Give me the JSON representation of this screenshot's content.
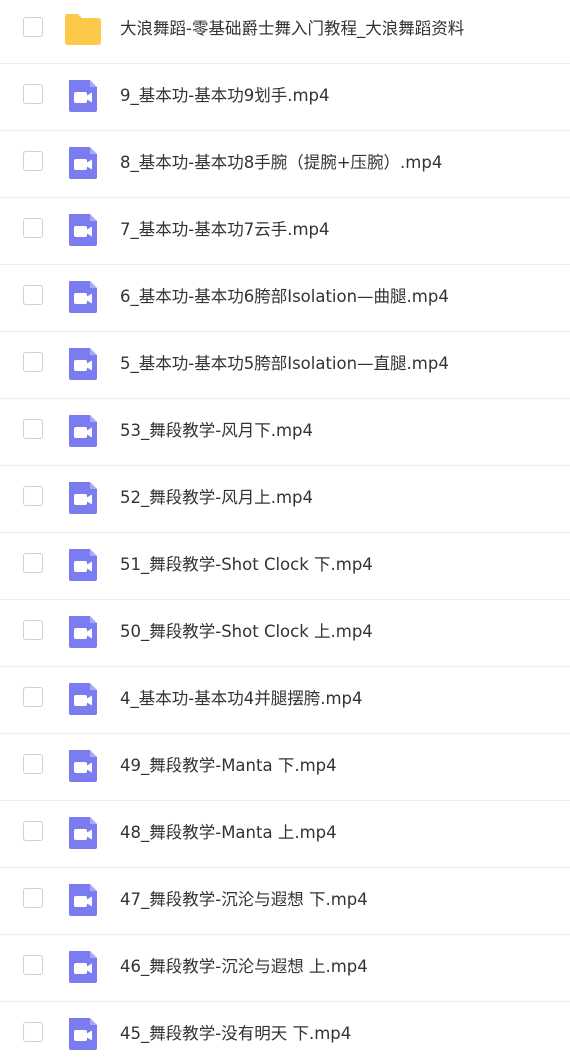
{
  "colors": {
    "folder": "#FBC94A",
    "video": "#7B7CF0"
  },
  "files": [
    {
      "type": "folder",
      "icon": "folder-icon",
      "name": "大浪舞蹈-零基础爵士舞入门教程_大浪舞蹈资料"
    },
    {
      "type": "video",
      "icon": "video-file-icon",
      "name": "9_基本功-基本功9划手.mp4"
    },
    {
      "type": "video",
      "icon": "video-file-icon",
      "name": "8_基本功-基本功8手腕（提腕+压腕）.mp4"
    },
    {
      "type": "video",
      "icon": "video-file-icon",
      "name": "7_基本功-基本功7云手.mp4"
    },
    {
      "type": "video",
      "icon": "video-file-icon",
      "name": "6_基本功-基本功6胯部Isolation—曲腿.mp4"
    },
    {
      "type": "video",
      "icon": "video-file-icon",
      "name": "5_基本功-基本功5胯部Isolation—直腿.mp4"
    },
    {
      "type": "video",
      "icon": "video-file-icon",
      "name": "53_舞段教学-风月下.mp4"
    },
    {
      "type": "video",
      "icon": "video-file-icon",
      "name": "52_舞段教学-风月上.mp4"
    },
    {
      "type": "video",
      "icon": "video-file-icon",
      "name": "51_舞段教学-Shot Clock 下.mp4"
    },
    {
      "type": "video",
      "icon": "video-file-icon",
      "name": "50_舞段教学-Shot Clock 上.mp4"
    },
    {
      "type": "video",
      "icon": "video-file-icon",
      "name": "4_基本功-基本功4并腿摆胯.mp4"
    },
    {
      "type": "video",
      "icon": "video-file-icon",
      "name": "49_舞段教学-Manta 下.mp4"
    },
    {
      "type": "video",
      "icon": "video-file-icon",
      "name": "48_舞段教学-Manta 上.mp4"
    },
    {
      "type": "video",
      "icon": "video-file-icon",
      "name": "47_舞段教学-沉沦与遐想 下.mp4"
    },
    {
      "type": "video",
      "icon": "video-file-icon",
      "name": "46_舞段教学-沉沦与遐想 上.mp4"
    },
    {
      "type": "video",
      "icon": "video-file-icon",
      "name": "45_舞段教学-没有明天 下.mp4"
    }
  ]
}
